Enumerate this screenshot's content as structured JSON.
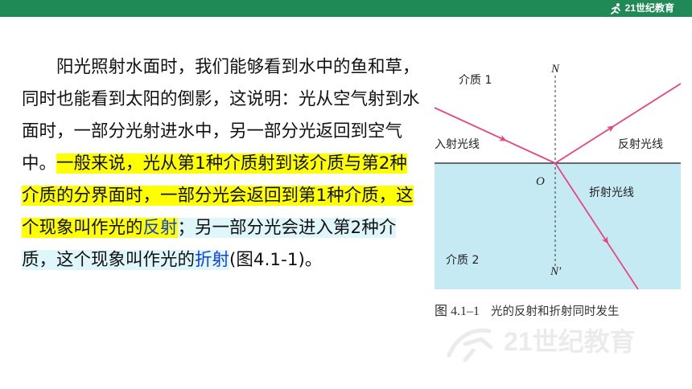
{
  "header": {
    "logo_text": "21世纪教育",
    "bar_color": "#1f8a55"
  },
  "paragraph": {
    "s1": "阳光照射水面时，我们能够看到水中的鱼和草，同时也能看到太阳的倒影，这说明：光从空气射到水面时，一部分光射进水中，另一部分光返回到空气中。",
    "s2": "一般来说，光从第1种介质射到该介质与第2种介质的分界面时，一部分光会返回到第1种介质，这个现象叫作光的",
    "term_reflection": "反射",
    "s3": "；另一部分光会进入第2种介质，这个现象叫作光的",
    "term_refraction": "折射",
    "s4": "(图4.1-1)。",
    "highlight_color": "#ffff00",
    "term_color": "#1340d8"
  },
  "figure": {
    "medium1": "介质 1",
    "medium2": "介质 2",
    "normal_top": "N",
    "normal_bottom": "N′",
    "origin": "O",
    "incident": "入射光线",
    "reflected": "反射光线",
    "refracted": "折射光线",
    "water_color": "#c6eaf4",
    "ray_color": "#e8457f"
  },
  "caption": {
    "number": "图 4.1–1",
    "text": "光的反射和折射同时发生"
  },
  "watermark": {
    "text": "21世纪教育"
  }
}
